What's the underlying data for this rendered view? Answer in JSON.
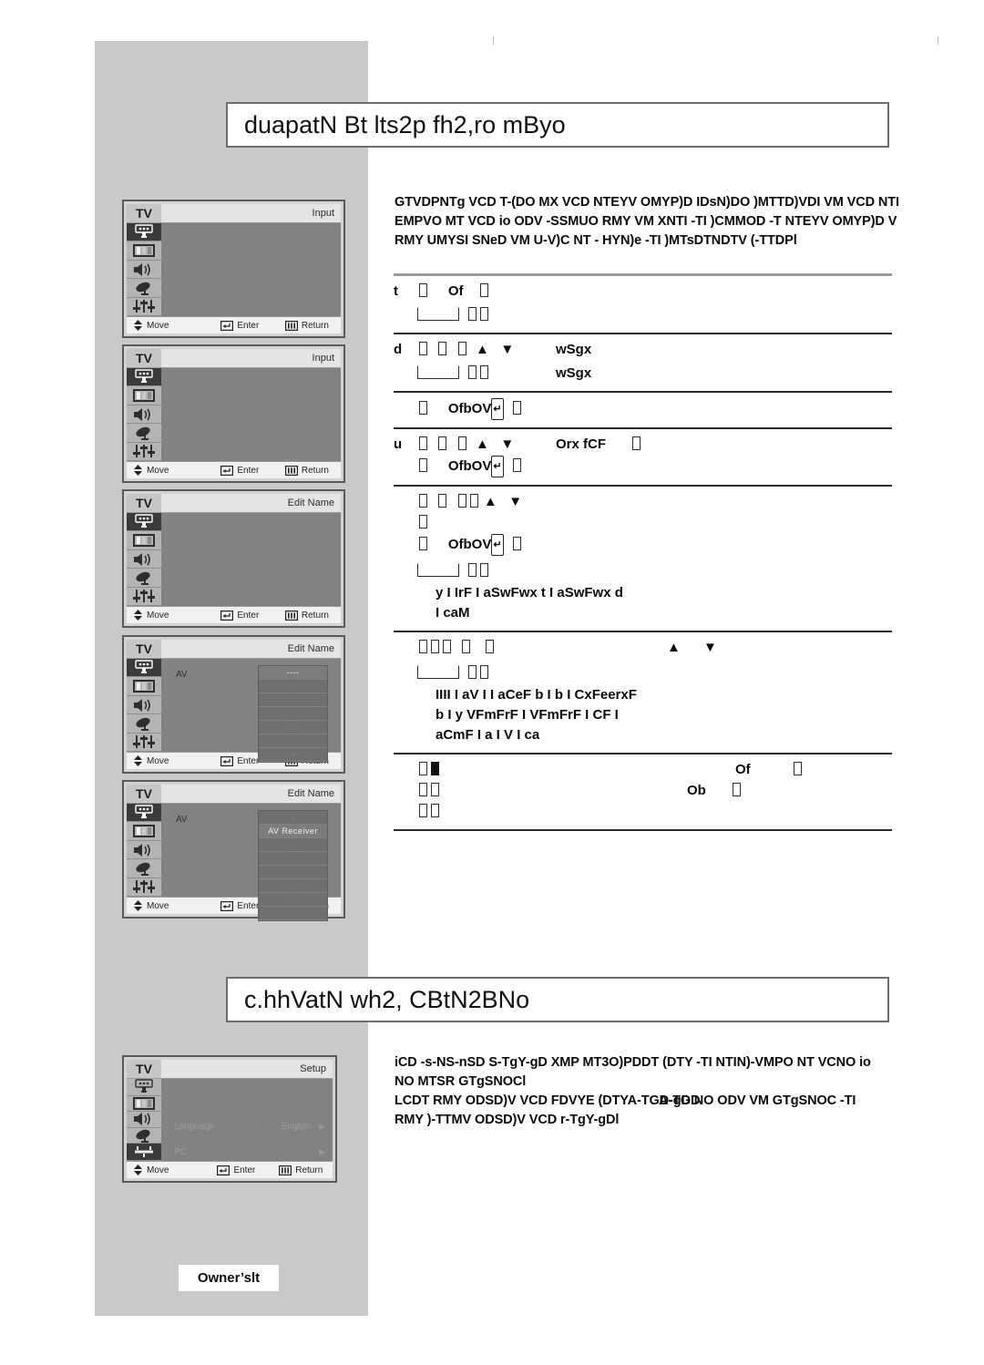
{
  "page": {
    "background_color": "#ffffff",
    "band_color": "#c9c9c9"
  },
  "sections": [
    {
      "id": "section-1",
      "heading": "duapatN Bt lts2p fh2,ro mByo",
      "intro_lines": [
        "GTVDPNTg VCD T-(DO MX VCD NTEYV OMYP)D IDsN)DO )MTTD)VDI VM VCD NTI",
        "EMPVO MT VCD io ODV -SSMUO RMY VM XNTI -TI )CMMOD -T NTEYV OMYP)D V",
        "RMY UMYSI SNeD VM U-V)C NT - HYN)e -TI )MTsDTNDTV (-TTDPl"
      ]
    },
    {
      "id": "section-2",
      "heading": "c.hhVatN wh2, CBtN2BNo",
      "intro_lines": [
        "iCD -s-NS-nSD S-TgY-gD XMP MT3O)PDDT (DTY -TI NTIN)-VMPO NT VCNO io",
        "NO MTSR GTgSNOCl",
        "LCDT RMY ODSD)V VCD FDVYE (DTYA-TGD-gD  NO ODV VM GTgSNOC -TI",
        "RMY )-TTMV ODSD)V VCD r-TgY-gDl"
      ],
      "overlay_text": "A-TGD"
    }
  ],
  "steps": [
    {
      "num": "t",
      "lines": [
        {
          "type": "main",
          "tokens": [
            "box",
            "Of",
            "box"
          ]
        },
        {
          "type": "sub",
          "tokens": [
            "longbox",
            "box",
            "boxpair"
          ]
        }
      ],
      "right": []
    },
    {
      "num": "d",
      "lines": [
        {
          "type": "main",
          "tokens": [
            "box",
            "box",
            "boxpair",
            "up",
            "down"
          ]
        },
        {
          "type": "sub",
          "tokens": [
            "longbox",
            "box",
            "boxpair2"
          ]
        }
      ],
      "right": [
        "wSgx",
        "wSgx"
      ]
    },
    {
      "num": "",
      "lines": [
        {
          "type": "main",
          "tokens": [
            "box",
            "OfbOV",
            "enter",
            "box"
          ]
        }
      ],
      "right": []
    },
    {
      "num": "u",
      "lines": [
        {
          "type": "main",
          "tokens": [
            "box",
            "box",
            "boxpair",
            "up",
            "down"
          ]
        },
        {
          "type": "sub2",
          "tokens": [
            "box",
            "OfbOV",
            "enter",
            "box"
          ]
        }
      ],
      "right": [
        "Orx fCF"
      ]
    },
    {
      "num": "",
      "lines": [
        {
          "type": "main",
          "tokens": [
            "box",
            "box",
            "boxpair2",
            "up",
            "down"
          ]
        },
        {
          "type": "box-only",
          "tokens": [
            "box"
          ]
        },
        {
          "type": "sub2",
          "tokens": [
            "box",
            "OfbOV",
            "enter",
            "box"
          ]
        },
        {
          "type": "sub",
          "tokens": [
            "longbox",
            "box",
            "boxpair2"
          ]
        }
      ],
      "wrapped": [
        "y I IrF I  aSwFwx t I aSwFwx d",
        "I caM"
      ],
      "right": []
    },
    {
      "num": "",
      "lines": [
        {
          "type": "triple",
          "tokens": [
            "boxtriple",
            "box",
            "box"
          ]
        },
        {
          "type": "sub",
          "tokens": [
            "longbox",
            "box",
            "boxpair2"
          ]
        }
      ],
      "wrapped": [
        "IIII I aV I  I aCeF b I  b I CxFeerxF",
        "b I  y VFmFrF I  VFmFrF I CF I",
        "aCmF I  a I V I ca"
      ],
      "arrows_right": true,
      "right": []
    },
    {
      "num": "",
      "lines": [],
      "final": true,
      "right": [
        "Of",
        "Ob"
      ]
    }
  ],
  "osd_common": {
    "tv_label": "TV",
    "footer": {
      "move": "Move",
      "enter": "Enter",
      "return": "Return"
    },
    "rail_icons": [
      "picture-input-icon",
      "picture-icon",
      "sound-icon",
      "channel-dish-icon",
      "setup-sliders-icon"
    ]
  },
  "osd_screens": [
    {
      "id": "osd-1",
      "screen_title": "Input",
      "selected_rail": 0,
      "av_label": null,
      "list": null,
      "setup": null
    },
    {
      "id": "osd-2",
      "screen_title": "Input",
      "selected_rail": 0,
      "av_label": null,
      "list": null,
      "setup": null
    },
    {
      "id": "osd-3",
      "screen_title": "Edit Name",
      "selected_rail": 0,
      "av_label": null,
      "list": null,
      "setup": null
    },
    {
      "id": "osd-4",
      "screen_title": "Edit Name",
      "selected_rail": 0,
      "av_label": "AV",
      "list": {
        "rows": [
          "----",
          ".",
          ".  .",
          ".   .",
          ":  . :",
          "",
          "--"
        ],
        "highlight_index": 0
      },
      "setup": null
    },
    {
      "id": "osd-5",
      "screen_title": "Edit Name",
      "selected_rail": 0,
      "av_label": "AV",
      "list": {
        "rows": [
          "-",
          "AV Receiver",
          ".  .  .  .",
          "",
          "",
          ".  .    .  .",
          ".  .",
          ""
        ],
        "highlight_index": 1
      },
      "setup": null
    },
    {
      "id": "osd-6",
      "screen_title": "Setup",
      "selected_rail": 4,
      "av_label": null,
      "list": null,
      "setup": {
        "rows": [
          {
            "name": "Language",
            "colon": ":",
            "value": "English",
            "arrow": "▶"
          },
          {
            "name": "PC",
            "colon": "",
            "value": "",
            "arrow": "▶"
          }
        ]
      }
    }
  ],
  "footer_badge": {
    "label": "Owner’slt"
  }
}
